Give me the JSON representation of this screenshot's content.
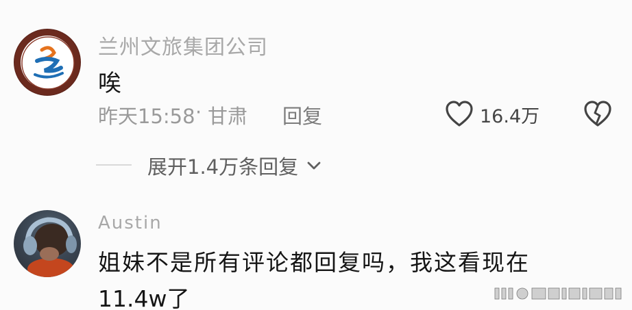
{
  "comment1": {
    "username": "兰州文旅集团公司",
    "text": "唉",
    "time": "昨天15:58",
    "dot": "·",
    "location": "甘肃",
    "reply_label": "回复",
    "like_count": "16.4万",
    "expand_label": "展开1.4万条回复"
  },
  "comment2": {
    "username": "Austin",
    "text_line1": "姐妹不是所有评论都回复吗，我这看现在",
    "text_line2": "11.4w了"
  },
  "icons": {
    "like": "heart-outline-icon",
    "dislike": "broken-heart-icon",
    "expand": "chevron-down-icon"
  },
  "colors": {
    "background": "#fbfbfb",
    "username": "#a8a8a8",
    "text": "#151515",
    "meta": "#9a9a9a",
    "logo_border": "#6b2a1e",
    "logo_blue": "#1f6fb5",
    "logo_orange": "#e5731e"
  }
}
